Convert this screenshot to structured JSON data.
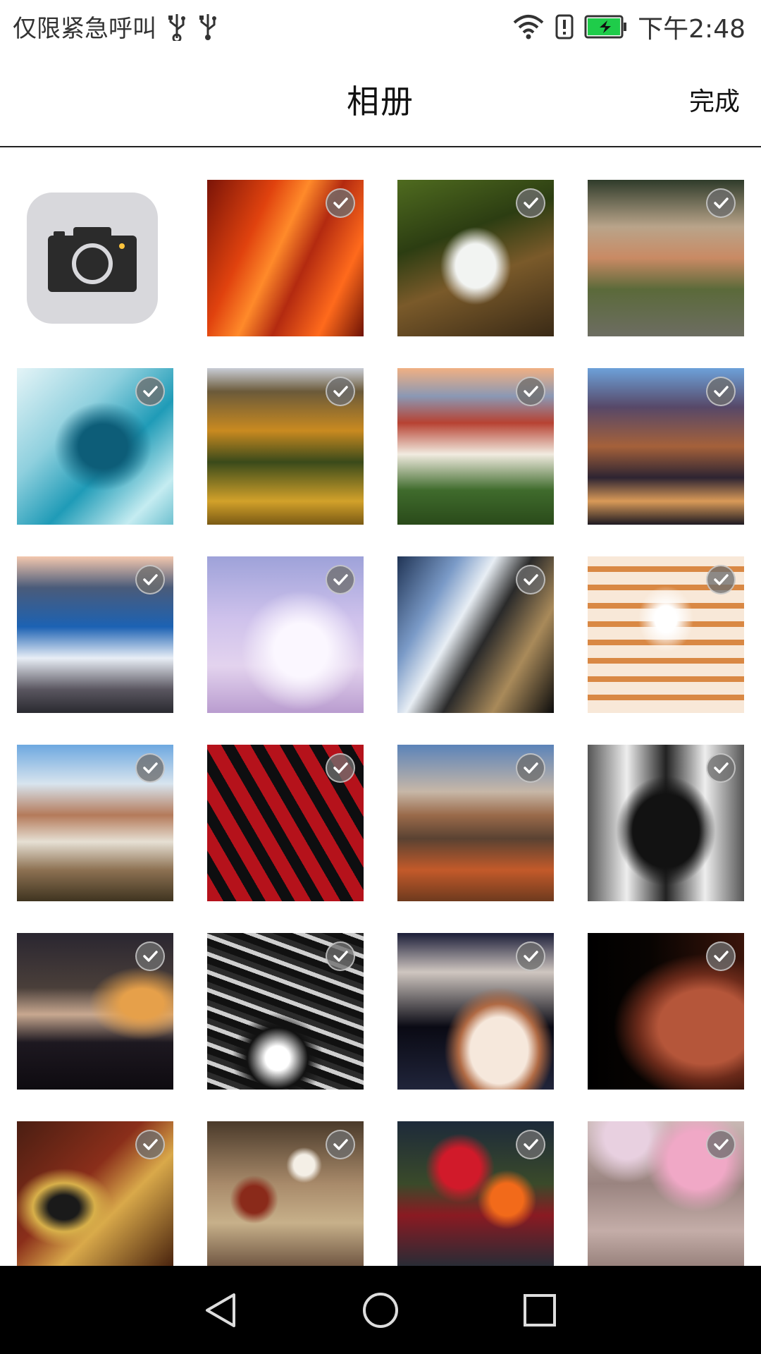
{
  "status_bar": {
    "carrier_text": "仅限紧急呼叫",
    "time": "下午2:48",
    "icons": [
      "usb-icon",
      "usb-icon",
      "wifi-icon",
      "alert-icon",
      "battery-charging-icon"
    ],
    "battery_color": "#1fcc4a"
  },
  "header": {
    "title": "相册",
    "done_label": "完成"
  },
  "grid": {
    "camera_icon": "camera-icon",
    "photos": [
      {
        "theme": "canyon-sandstone",
        "selected": true
      },
      {
        "theme": "waterfall-moss",
        "selected": true
      },
      {
        "theme": "village-street",
        "selected": true
      },
      {
        "theme": "ocean-wave",
        "selected": true
      },
      {
        "theme": "autumn-forest",
        "selected": true
      },
      {
        "theme": "old-town-towers",
        "selected": true
      },
      {
        "theme": "canal-houses-bridge",
        "selected": true
      },
      {
        "theme": "lake-driftwood",
        "selected": true
      },
      {
        "theme": "snowy-trees-lavender",
        "selected": true
      },
      {
        "theme": "metal-architecture",
        "selected": true
      },
      {
        "theme": "geometric-tunnel",
        "selected": true
      },
      {
        "theme": "castle-bridge-river",
        "selected": true
      },
      {
        "theme": "temple-eaves-red",
        "selected": true
      },
      {
        "theme": "desert-rock",
        "selected": true
      },
      {
        "theme": "bw-curved-structure",
        "selected": true
      },
      {
        "theme": "mountain-sunset",
        "selected": true
      },
      {
        "theme": "chrome-engine",
        "selected": true
      },
      {
        "theme": "wine-glasses-dinner",
        "selected": true
      },
      {
        "theme": "violin-closeup",
        "selected": true
      },
      {
        "theme": "golf-clubs-gold",
        "selected": true
      },
      {
        "theme": "tea-set",
        "selected": true
      },
      {
        "theme": "flower-bouquet",
        "selected": true
      },
      {
        "theme": "pink-peonies-wood",
        "selected": true
      }
    ]
  },
  "nav_bar": {
    "icons": [
      "back-triangle-icon",
      "home-circle-icon",
      "recents-square-icon"
    ]
  }
}
